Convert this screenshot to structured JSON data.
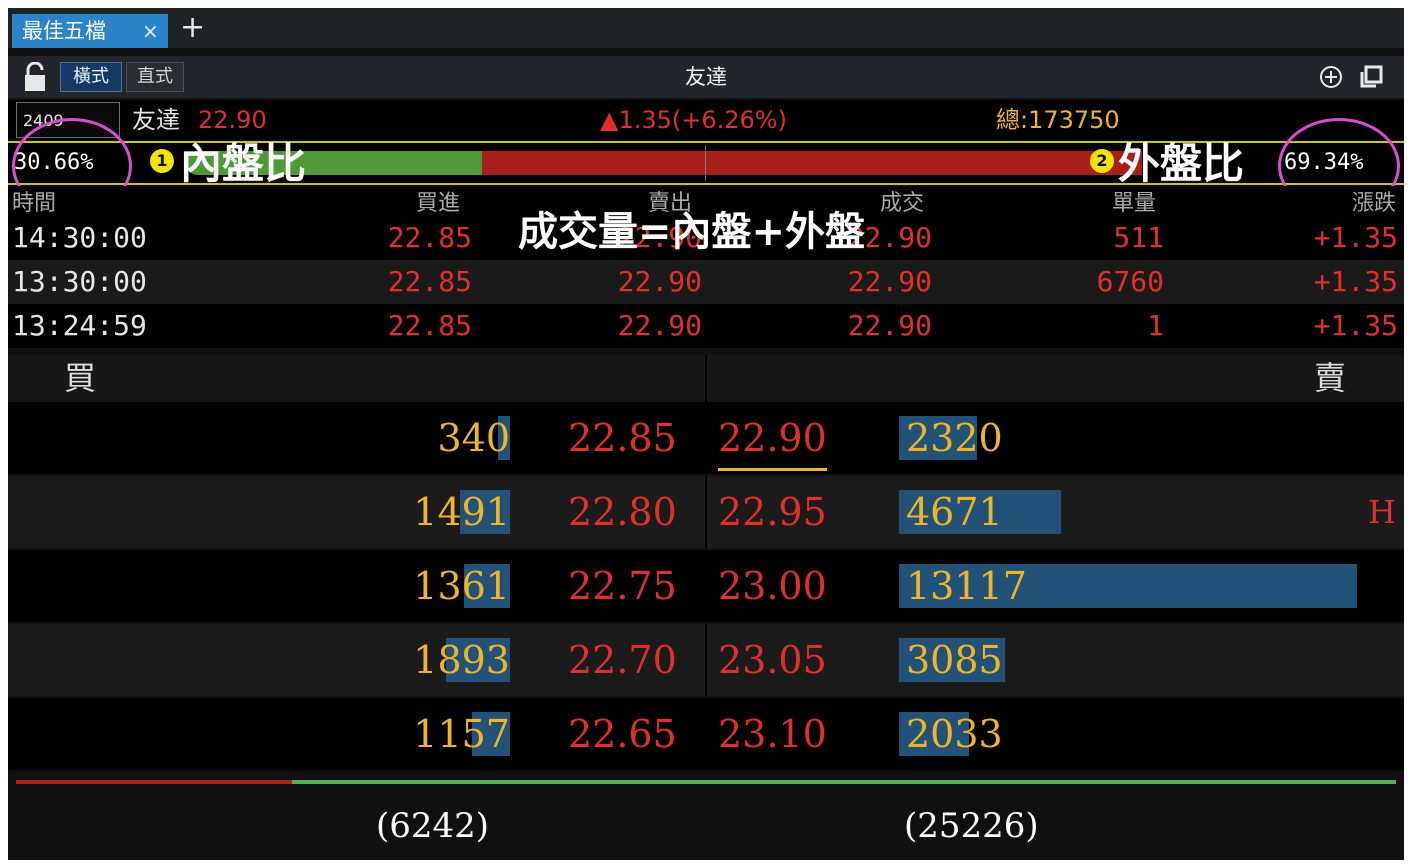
{
  "colors": {
    "accent": "#2b84c8",
    "up_red": "#e0302a",
    "bid_orange": "#f0b429",
    "neutral": "#e6e6e6",
    "bar_blue": "#225277",
    "highlight_pink": "#d94bd3"
  },
  "tab": {
    "label": "最佳五檔",
    "close": "×",
    "new": "+"
  },
  "toolbar": {
    "mode_horizontal": "橫式",
    "mode_vertical": "直式",
    "title": "友達"
  },
  "quote": {
    "code": "2409",
    "name": "友達",
    "price": "22.90",
    "change": "▲1.35(+6.26%)",
    "total": "總:173750"
  },
  "ratio": {
    "inner_pct": "30.66%",
    "outer_pct": "69.34%",
    "inner_fraction": 0.3066,
    "outer_fraction": 0.6934,
    "annotation_inner": "內盤比",
    "annotation_outer": "外盤比",
    "badge_inner": "1",
    "badge_outer": "2"
  },
  "trade_table": {
    "headers": [
      "時間",
      "買進",
      "賣出",
      "成交",
      "單量",
      "漲跌"
    ],
    "rows": [
      {
        "time": "14:30:00",
        "buy": "22.85",
        "sell": "22.90",
        "deal": "22.90",
        "vol": "511",
        "chg": "+1.35"
      },
      {
        "time": "13:30:00",
        "buy": "22.85",
        "sell": "22.90",
        "deal": "22.90",
        "vol": "6760",
        "chg": "+1.35"
      },
      {
        "time": "13:24:59",
        "buy": "22.85",
        "sell": "22.90",
        "deal": "22.90",
        "vol": "1",
        "chg": "+1.35"
      }
    ],
    "annotation": "成交量=內盤+外盤"
  },
  "book": {
    "buy_label": "買",
    "sell_label": "賣",
    "levels": [
      {
        "bid_qty": "340",
        "bid": "22.85",
        "ask": "22.90",
        "ask_qty": "2320",
        "flag": ""
      },
      {
        "bid_qty": "1491",
        "bid": "22.80",
        "ask": "22.95",
        "ask_qty": "4671",
        "flag": "H"
      },
      {
        "bid_qty": "1361",
        "bid": "22.75",
        "ask": "23.00",
        "ask_qty": "13117",
        "flag": ""
      },
      {
        "bid_qty": "1893",
        "bid": "22.70",
        "ask": "23.05",
        "ask_qty": "3085",
        "flag": ""
      },
      {
        "bid_qty": "1157",
        "bid": "22.65",
        "ask": "23.10",
        "ask_qty": "2033",
        "flag": ""
      }
    ],
    "bid_total": "(6242)",
    "ask_total": "(25226)"
  }
}
